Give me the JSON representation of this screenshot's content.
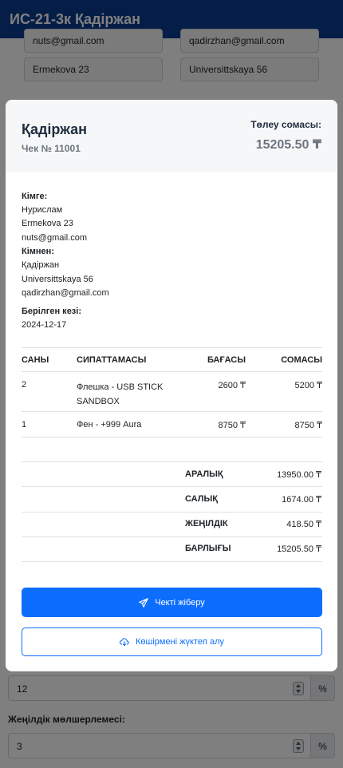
{
  "app": {
    "title": "ИС-21-3к Қадіржан"
  },
  "background_form": {
    "recipient_email": "nuts@gmail.com",
    "sender_email": "qadirzhan@gmail.com",
    "recipient_address": "Ermekova 23",
    "sender_address": "Universittskaya 56",
    "tax_rate_value": "12",
    "discount_label": "Жеңілдік мөлшерлемесі:",
    "discount_value": "3",
    "percent_addon": "%"
  },
  "invoice": {
    "customer_name": "Қадіржан",
    "check_number": "Чек № 11001",
    "payment_label": "Төлеу сомасы:",
    "payment_amount": "15205.50 ₸",
    "to_label": "Кімге:",
    "to_name": "Нурислам",
    "to_address": "Ermekova 23",
    "to_email": "nuts@gmail.com",
    "from_label": "Кімнен:",
    "from_name": "Қадіржан",
    "from_address": "Universittskaya 56",
    "from_email": "qadirzhan@gmail.com",
    "issued_label": "Берілген кезі:",
    "issued_date": "2024-12-17",
    "columns": [
      "САНЫ",
      "СИПАТТАМАСЫ",
      "БАҒАСЫ",
      "СОМАСЫ"
    ],
    "items": [
      {
        "qty": "2",
        "desc_line1": "Флешка - USB STICK",
        "desc_line2": "SANDBOX",
        "price": "2600 ₸",
        "amount": "5200 ₸"
      },
      {
        "qty": "1",
        "desc_line1": "Фен - +999 Aura",
        "desc_line2": "",
        "price": "8750 ₸",
        "amount": "8750 ₸"
      }
    ],
    "totals": [
      {
        "label": "АРАЛЫҚ",
        "value": "13950.00 ₸"
      },
      {
        "label": "САЛЫҚ",
        "value": "1674.00 ₸"
      },
      {
        "label": "ЖЕҢІЛДІК",
        "value": "418.50 ₸"
      },
      {
        "label": "БАРЛЫҒЫ",
        "value": "15205.50 ₸"
      }
    ],
    "send_button": "Чекті жіберу",
    "download_button": "Көшірмені жүктеп алу"
  },
  "colors": {
    "primary": "#0d6efd",
    "appbar": "#0b3d91"
  },
  "icons": {
    "send": "paper-plane-icon",
    "download": "cloud-download-icon"
  }
}
